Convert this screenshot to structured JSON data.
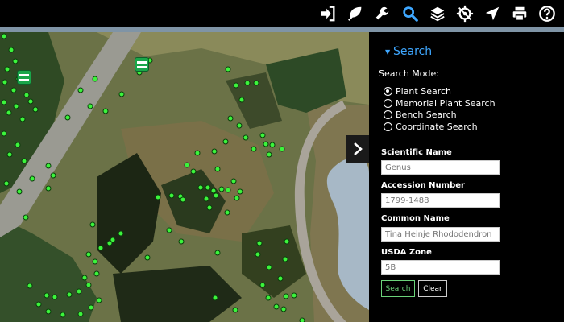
{
  "toolbar": {
    "buttons": [
      "login-icon",
      "leaf-icon",
      "wrench-icon",
      "search-icon",
      "layers-icon",
      "locate-icon",
      "navigate-icon",
      "print-icon",
      "help-icon"
    ],
    "active": "search-icon",
    "accent_color": "#3ea7ff"
  },
  "panel": {
    "title": "Search",
    "mode_label": "Search Mode:",
    "modes": [
      "Plant Search",
      "Memorial Plant Search",
      "Bench Search",
      "Coordinate Search"
    ],
    "selected_mode": "Plant Search",
    "fields": {
      "scientific_name": {
        "label": "Scientific Name",
        "placeholder": "Genus"
      },
      "accession_number": {
        "label": "Accession Number",
        "placeholder": "1799-1488"
      },
      "common_name": {
        "label": "Common Name",
        "placeholder": "Tina Heinje Rhododendron"
      },
      "usda_zone": {
        "label": "USDA Zone",
        "placeholder": "5B"
      }
    },
    "search_label": "Search",
    "clear_label": "Clear"
  },
  "map": {
    "marker_color": "#3cf43c",
    "bench_color": "#1aa64a"
  }
}
